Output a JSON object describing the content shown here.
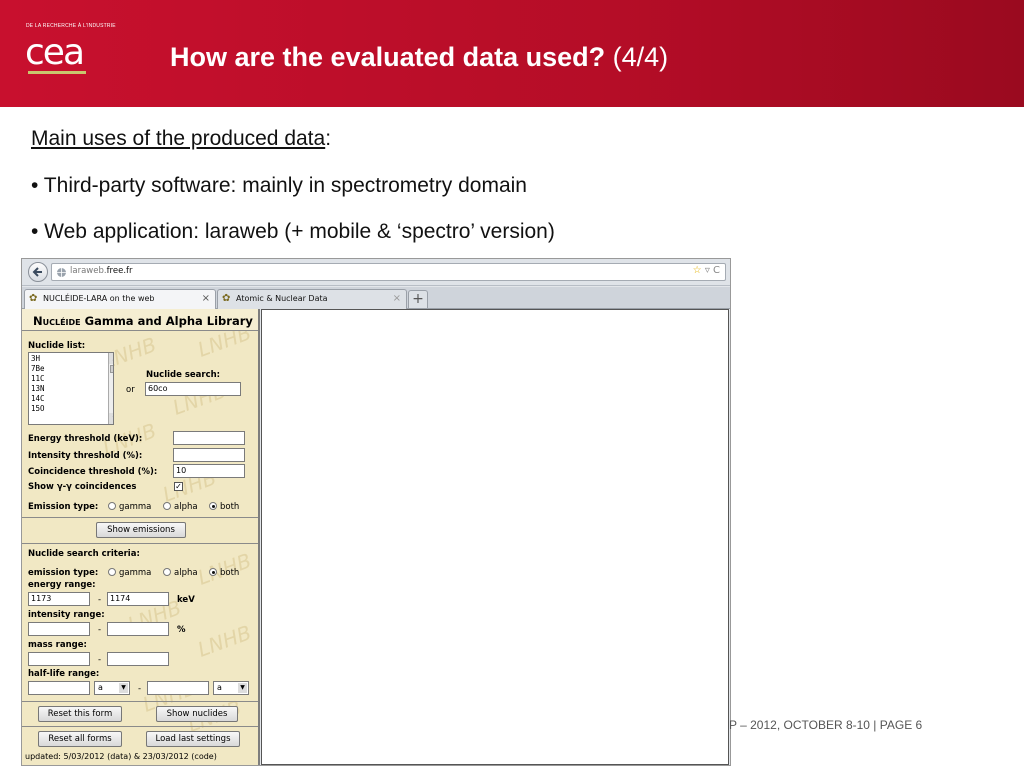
{
  "slide": {
    "tagline": "DE LA RECHERCHE À L'INDUSTRIE",
    "logo_text": "cea",
    "title_bold": "How are the evaluated data used?",
    "title_rest": " (4/4)",
    "heading": "Main uses of the produced data",
    "heading_colon": ":",
    "bullets": [
      "• Third-party software: mainly in spectrometry domain",
      "• Web application: laraweb (+ mobile & ‘spectro’ version)"
    ],
    "footer": "P – 2012, OCTOBER 8-10 |  PAGE 6"
  },
  "colors": {
    "header_red": "#c8102e",
    "panel_beige": "#f1e8c4"
  },
  "browser": {
    "url_host_prefix": "laraweb.",
    "url_host_domain": "free.fr",
    "url_icons": "▿ C",
    "tabs": [
      {
        "label": "NUCLÉIDE-LARA on the web",
        "close": "×",
        "active": true
      },
      {
        "label": "Atomic & Nuclear Data",
        "close": "×",
        "active": false
      }
    ],
    "new_tab": "+"
  },
  "app": {
    "title_sc": "Nucléide",
    "title_rest": " Gamma and Alpha Library",
    "watermark": "LNHB",
    "nuclide_list_label": "Nuclide list:",
    "nuclide_list": [
      "3H",
      "7Be",
      "11C",
      "13N",
      "14C",
      "15O"
    ],
    "or_label": "or",
    "nuclide_search_label": "Nuclide search:",
    "nuclide_search_value": "60co",
    "energy_threshold_label": "Energy threshold (keV):",
    "energy_threshold_value": "",
    "intensity_threshold_label": "Intensity threshold (%):",
    "intensity_threshold_value": "",
    "coincidence_threshold_label": "Coincidence threshold (%):",
    "coincidence_threshold_value": "10",
    "show_coincidences_label": "Show γ-γ coincidences",
    "show_coincidences_checked": true,
    "emission_type_label": "Emission type:",
    "emission_options": [
      "gamma",
      "alpha",
      "both"
    ],
    "emission_selected": "both",
    "show_emissions_button": "Show emissions",
    "search_criteria_label": "Nuclide search criteria:",
    "criteria_emission_label": "emission type:",
    "criteria_emission_selected": "both",
    "energy_range_label": "energy range:",
    "energy_min": "1173",
    "energy_max": "1174",
    "energy_unit": "keV",
    "range_dash": "-",
    "intensity_range_label": "intensity range:",
    "intensity_unit": "%",
    "mass_range_label": "mass range:",
    "half_life_range_label": "half-life range:",
    "half_life_unit_min": "a",
    "half_life_unit_max": "a",
    "reset_form_button": "Reset this form",
    "show_nuclides_button": "Show nuclides",
    "reset_all_button": "Reset all forms",
    "load_last_button": "Load last settings",
    "updated_text": "updated: 5/03/2012 (data) & 23/03/2012 (code)"
  }
}
